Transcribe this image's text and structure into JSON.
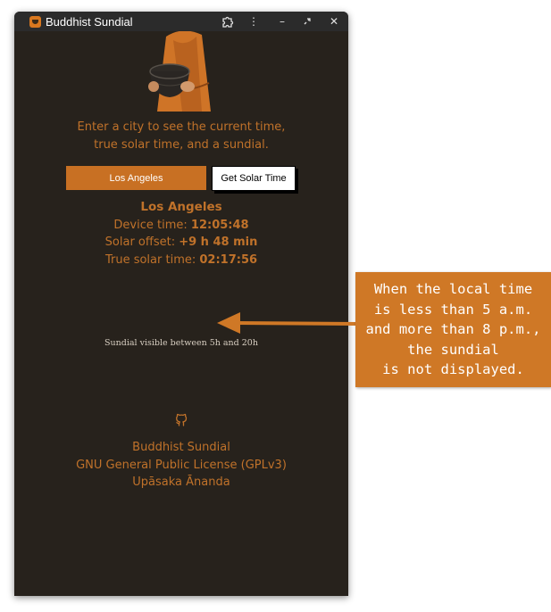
{
  "window": {
    "title": "Buddhist Sundial",
    "buttons": [
      "puzzle-icon",
      "kebab-menu-icon",
      "minimize-icon",
      "restore-icon",
      "close-icon"
    ]
  },
  "intro": {
    "line1": "Enter a city to see the current time,",
    "line2": "true solar time, and a sundial."
  },
  "form": {
    "city_value": "Los Angeles",
    "button_label": "Get Solar Time"
  },
  "results": {
    "city": "Los Angeles",
    "device_label": "Device time: ",
    "device_value": "12:05:48",
    "offset_label": "Solar offset: ",
    "offset_value": "+9 h 48 min",
    "solar_label": "True solar time: ",
    "solar_value": "02:17:56"
  },
  "sundial_note": "Sundial visible between 5h and 20h",
  "footer": {
    "line1": "Buddhist Sundial",
    "line2": "GNU General Public License (GPLv3)",
    "line3": "Upāsaka Ānanda"
  },
  "callout": {
    "line1": "When the local time",
    "line2": "is less than 5 a.m.",
    "line3": "and more than 8 p.m.,",
    "line4": "the sundial",
    "line5": "is not displayed."
  },
  "colors": {
    "background": "#27221c",
    "accent": "#c87023",
    "callout": "#cf7826"
  }
}
